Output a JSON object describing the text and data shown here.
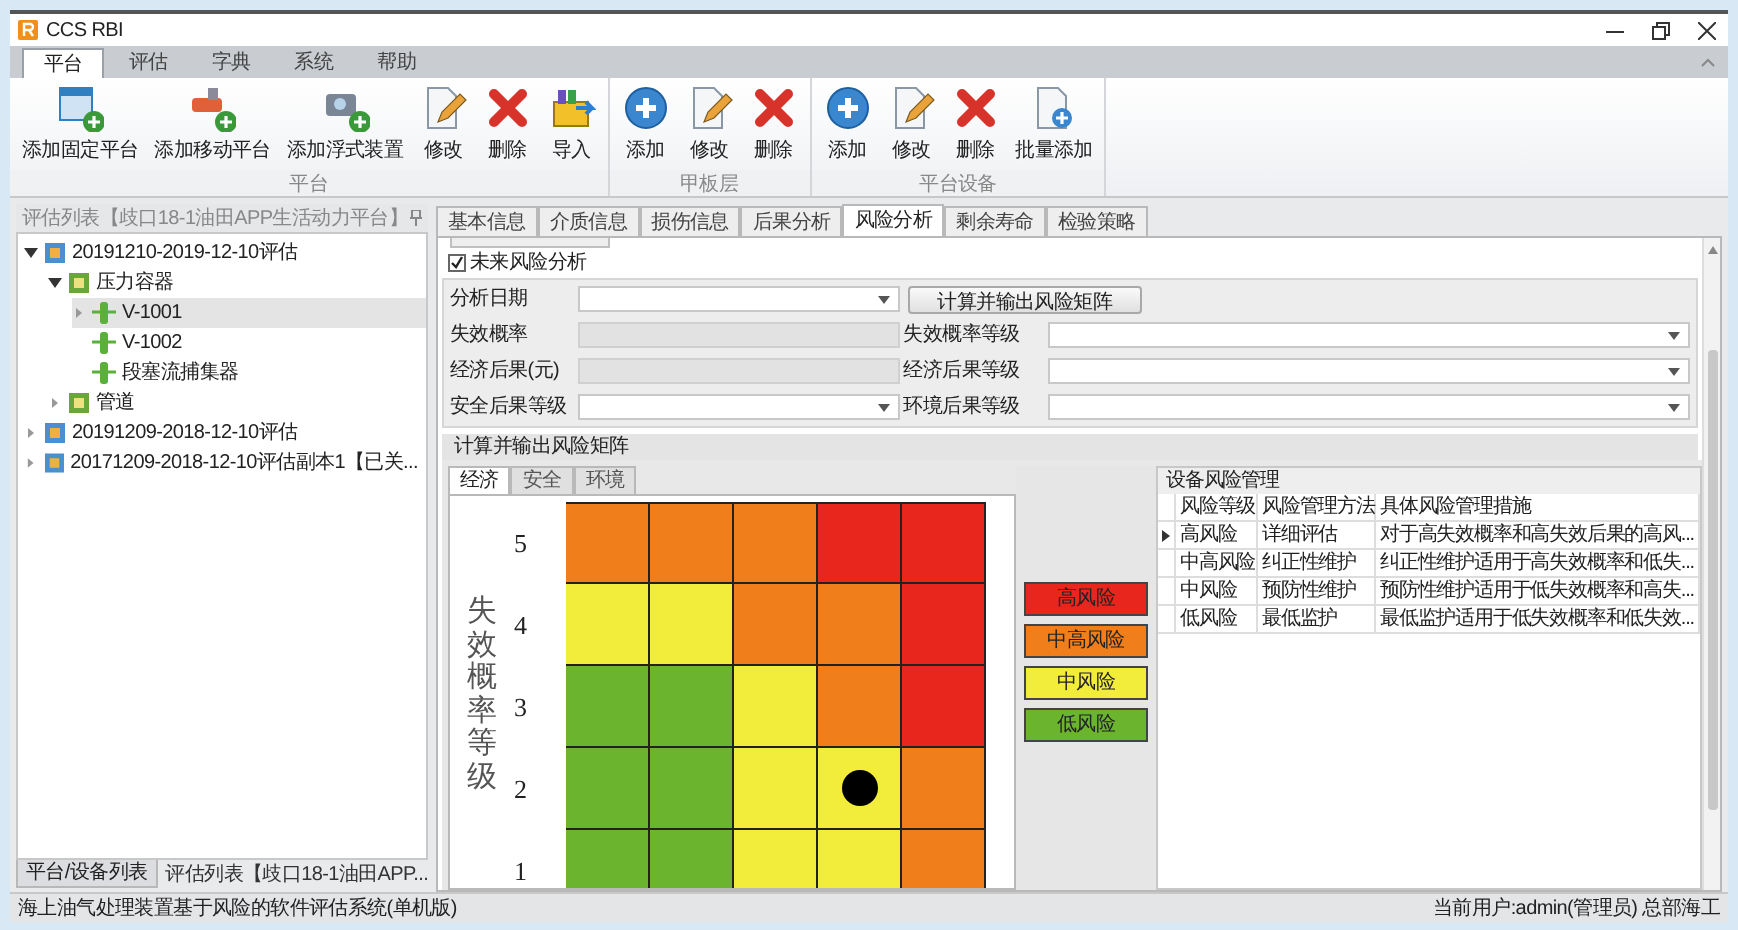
{
  "window": {
    "title": "CCS RBI"
  },
  "menu_tabs": [
    {
      "label": "平台",
      "selected": true
    },
    {
      "label": "评估",
      "selected": false
    },
    {
      "label": "字典",
      "selected": false
    },
    {
      "label": "系统",
      "selected": false
    },
    {
      "label": "帮助",
      "selected": false
    }
  ],
  "ribbon_groups": [
    {
      "label": "平台",
      "buttons": [
        {
          "label": "添加固定平台",
          "kind": "add_fixed"
        },
        {
          "label": "添加移动平台",
          "kind": "add_mobile"
        },
        {
          "label": "添加浮式装置",
          "kind": "add_floating"
        },
        {
          "label": "修改",
          "kind": "edit"
        },
        {
          "label": "删除",
          "kind": "delete"
        },
        {
          "label": "导入",
          "kind": "import"
        }
      ]
    },
    {
      "label": "甲板层",
      "buttons": [
        {
          "label": "添加",
          "kind": "add"
        },
        {
          "label": "修改",
          "kind": "edit"
        },
        {
          "label": "删除",
          "kind": "delete"
        }
      ]
    },
    {
      "label": "平台设备",
      "buttons": [
        {
          "label": "添加",
          "kind": "add"
        },
        {
          "label": "修改",
          "kind": "edit"
        },
        {
          "label": "删除",
          "kind": "delete"
        },
        {
          "label": "批量添加",
          "kind": "batch_add"
        }
      ]
    }
  ],
  "left_panel": {
    "title": "评估列表【歧口18-1油田APP生活动力平台】",
    "tree": [
      {
        "label": "20191210-2019-12-10评估",
        "kind": "assessment",
        "expandable": true,
        "expanded": true,
        "selected": false,
        "children": [
          {
            "label": "压力容器",
            "kind": "category",
            "expandable": true,
            "expanded": true,
            "selected": false,
            "children": [
              {
                "label": "V-1001",
                "kind": "equipment",
                "expandable": true,
                "expanded": false,
                "selected": true
              },
              {
                "label": "V-1002",
                "kind": "equipment",
                "expandable": false,
                "selected": false
              },
              {
                "label": "段塞流捕集器",
                "kind": "equipment",
                "expandable": false,
                "selected": false
              }
            ]
          },
          {
            "label": "管道",
            "kind": "category",
            "expandable": true,
            "expanded": false,
            "selected": false
          }
        ]
      },
      {
        "label": "20191209-2018-12-10评估",
        "kind": "assessment",
        "expandable": true,
        "expanded": false,
        "selected": false
      },
      {
        "label": "20171209-2018-12-10评估副本1【已关...",
        "kind": "assessment",
        "expandable": true,
        "expanded": false,
        "selected": false
      }
    ],
    "bottom_tabs": [
      {
        "label": "平台/设备列表",
        "selected": true
      },
      {
        "label": "评估列表【歧口18-1油田APP...",
        "selected": false
      }
    ]
  },
  "detail_tabs": [
    {
      "label": "基本信息",
      "selected": false
    },
    {
      "label": "介质信息",
      "selected": false
    },
    {
      "label": "损伤信息",
      "selected": false
    },
    {
      "label": "后果分析",
      "selected": false
    },
    {
      "label": "风险分析",
      "selected": true
    },
    {
      "label": "剩余寿命",
      "selected": false
    },
    {
      "label": "检验策略",
      "selected": false
    }
  ],
  "future_risk": {
    "label": "未来风险分析",
    "checked": true
  },
  "analysis_date": {
    "label": "分析日期"
  },
  "calc_button": "计算并输出风险矩阵",
  "fields": [
    {
      "label": "失效概率",
      "kind": "readonly"
    },
    {
      "label": "失效概率等级",
      "kind": "dropdown"
    },
    {
      "label": "经济后果(元)",
      "kind": "readonly"
    },
    {
      "label": "经济后果等级",
      "kind": "dropdown"
    },
    {
      "label": "安全后果等级",
      "kind": "dropdown"
    },
    {
      "label": "环境后果等级",
      "kind": "dropdown"
    }
  ],
  "matrix_group": {
    "title": "计算并输出风险矩阵",
    "tabs": [
      {
        "label": "经济",
        "selected": true
      },
      {
        "label": "安全",
        "selected": false
      },
      {
        "label": "环境",
        "selected": false
      }
    ],
    "y_label": "失效概率等级",
    "rows": [
      {
        "label": "5",
        "cells": [
          {
            "color": "#f07f1b"
          },
          {
            "color": "#f07f1b"
          },
          {
            "color": "#f07f1b"
          },
          {
            "color": "#e8261e"
          },
          {
            "color": "#e8261e"
          }
        ]
      },
      {
        "label": "4",
        "cells": [
          {
            "color": "#f2ec3a"
          },
          {
            "color": "#f2ec3a"
          },
          {
            "color": "#f07f1b"
          },
          {
            "color": "#f07f1b"
          },
          {
            "color": "#e8261e"
          }
        ]
      },
      {
        "label": "3",
        "cells": [
          {
            "color": "#6ab42e"
          },
          {
            "color": "#6ab42e"
          },
          {
            "color": "#f2ec3a"
          },
          {
            "color": "#f07f1b"
          },
          {
            "color": "#e8261e"
          }
        ]
      },
      {
        "label": "2",
        "cells": [
          {
            "color": "#6ab42e"
          },
          {
            "color": "#6ab42e"
          },
          {
            "color": "#f2ec3a"
          },
          {
            "color": "#f2ec3a",
            "marked": true
          },
          {
            "color": "#f07f1b"
          }
        ]
      },
      {
        "label": "1",
        "cells": [
          {
            "color": "#6ab42e"
          },
          {
            "color": "#6ab42e"
          },
          {
            "color": "#f2ec3a"
          },
          {
            "color": "#f2ec3a"
          },
          {
            "color": "#f07f1b"
          }
        ]
      }
    ]
  },
  "legend": [
    {
      "label": "高风险",
      "color": "#e8261e"
    },
    {
      "label": "中高风险",
      "color": "#f07f1b"
    },
    {
      "label": "中风险",
      "color": "#f2ec3a"
    },
    {
      "label": "低风险",
      "color": "#6ab42e"
    }
  ],
  "risk_table": {
    "title": "设备风险管理",
    "columns": [
      "风险等级",
      "风险管理方法",
      "具体风险管理措施"
    ],
    "rows": [
      {
        "selected": true,
        "cells": [
          "高风险",
          "详细评估",
          "对于高失效概率和高失效后果的高风..."
        ]
      },
      {
        "selected": false,
        "cells": [
          "中高风险",
          "纠正性维护",
          "纠正性维护适用于高失效概率和低失..."
        ]
      },
      {
        "selected": false,
        "cells": [
          "中风险",
          "预防性维护",
          "预防性维护适用于低失效概率和高失..."
        ]
      },
      {
        "selected": false,
        "cells": [
          "低风险",
          "最低监护",
          "最低监护适用于低失效概率和低失效..."
        ]
      }
    ]
  },
  "status_bar": {
    "left": "海上油气处理装置基于风险的软件评估系统(单机版)",
    "right": "当前用户:admin(管理员) 总部海工"
  }
}
